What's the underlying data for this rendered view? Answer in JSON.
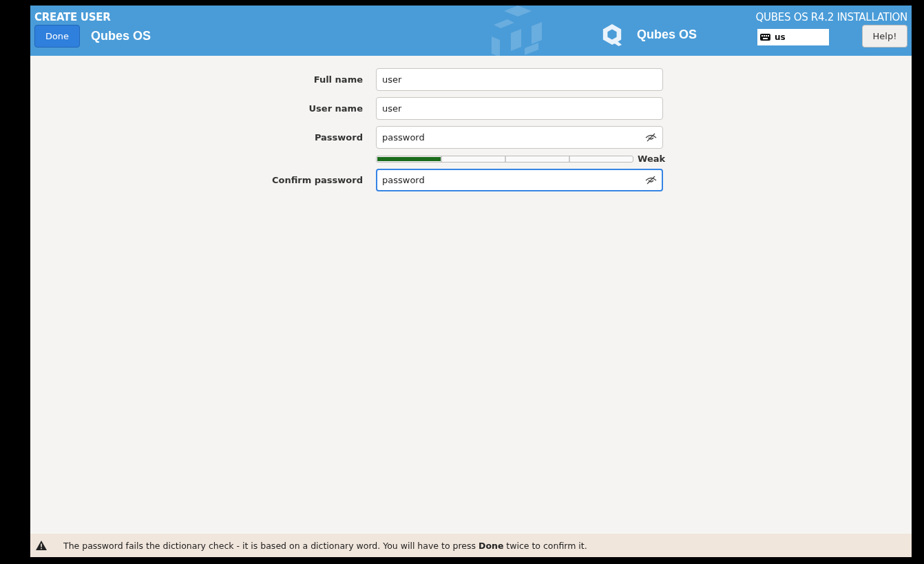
{
  "header": {
    "title": "CREATE USER",
    "done_button": "Done",
    "product": "Qubes OS",
    "logo_text": "Qubes OS",
    "installer_title": "QUBES OS R4.2 INSTALLATION",
    "keyboard_layout": "us",
    "help_button": "Help!"
  },
  "form": {
    "fields": [
      {
        "kind": "text",
        "label": "Full name",
        "value": "user",
        "focused": false
      },
      {
        "kind": "text",
        "label": "User name",
        "value": "user",
        "focused": false
      },
      {
        "kind": "password",
        "label": "Password",
        "value": "password",
        "focused": false
      },
      {
        "kind": "strength",
        "level": 0.25,
        "reading": "Weak"
      },
      {
        "kind": "password",
        "label": "Confirm password",
        "value": "password",
        "focused": true
      }
    ]
  },
  "warning": {
    "message": "The password fails the dictionary check - it is based on a dictionary word. You will have to press **Done** twice to confirm it."
  }
}
